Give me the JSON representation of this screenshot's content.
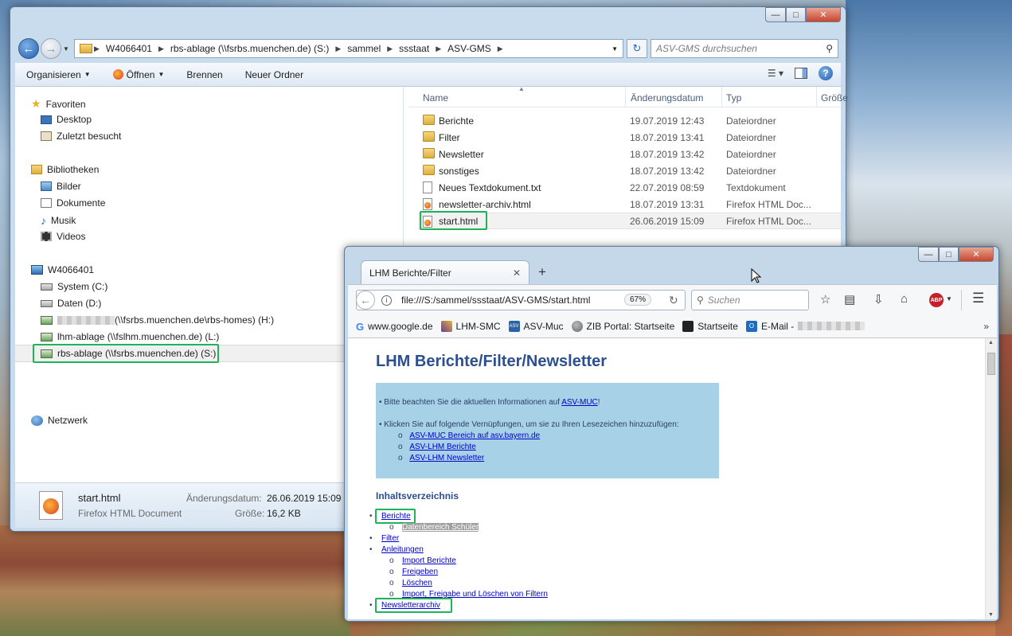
{
  "explorer": {
    "breadcrumb": [
      "W4066401",
      "rbs-ablage (\\\\fsrbs.muenchen.de) (S:)",
      "sammel",
      "ssstaat",
      "ASV-GMS"
    ],
    "search_placeholder": "ASV-GMS durchsuchen",
    "toolbar": {
      "organize": "Organisieren",
      "open": "Öffnen",
      "burn": "Brennen",
      "new_folder": "Neuer Ordner"
    },
    "nav": {
      "favorites": "Favoriten",
      "desktop": "Desktop",
      "recent": "Zuletzt besucht",
      "libraries": "Bibliotheken",
      "pictures": "Bilder",
      "documents": "Dokumente",
      "music": "Musik",
      "videos": "Videos",
      "computer": "W4066401",
      "system": "System  (C:)",
      "data": "Daten (D:)",
      "homes": "(\\\\fsrbs.muenchen.de\\rbs-homes) (H:)",
      "lhm": "lhm-ablage (\\\\fslhm.muenchen.de) (L:)",
      "rbs": "rbs-ablage (\\\\fsrbs.muenchen.de) (S:)",
      "network": "Netzwerk"
    },
    "columns": {
      "name": "Name",
      "date": "Änderungsdatum",
      "type": "Typ",
      "size": "Größe"
    },
    "files": [
      {
        "name": "Berichte",
        "date": "19.07.2019 12:43",
        "type": "Dateiordner",
        "icon": "folder"
      },
      {
        "name": "Filter",
        "date": "18.07.2019 13:41",
        "type": "Dateiordner",
        "icon": "folder"
      },
      {
        "name": "Newsletter",
        "date": "18.07.2019 13:42",
        "type": "Dateiordner",
        "icon": "folder"
      },
      {
        "name": "sonstiges",
        "date": "18.07.2019 13:42",
        "type": "Dateiordner",
        "icon": "folder"
      },
      {
        "name": "Neues Textdokument.txt",
        "date": "22.07.2019 08:59",
        "type": "Textdokument",
        "icon": "txt"
      },
      {
        "name": "newsletter-archiv.html",
        "date": "18.07.2019 13:31",
        "type": "Firefox HTML Doc...",
        "icon": "html"
      },
      {
        "name": "start.html",
        "date": "26.06.2019 15:09",
        "type": "Firefox HTML Doc...",
        "icon": "html"
      }
    ],
    "details": {
      "filename": "start.html",
      "filetype": "Firefox HTML Document",
      "date_label": "Änderungsdatum:",
      "date_value": "26.06.2019 15:09",
      "size_label": "Größe:",
      "size_value": "16,2 KB"
    }
  },
  "firefox": {
    "tab_title": "LHM Berichte/Filter",
    "url": "file:///S:/sammel/ssstaat/ASV-GMS/start.html",
    "zoom": "67%",
    "search_placeholder": "Suchen",
    "bookmarks": [
      "www.google.de",
      "LHM-SMC",
      "ASV-Muc",
      "ZIB Portal: Startseite",
      "Startseite",
      "E-Mail -"
    ],
    "page": {
      "title": "LHM Berichte/Filter/Newsletter",
      "info1_prefix": "Bitte beachten Sie die aktuellen Informationen auf ",
      "info1_link": "ASV-MUC",
      "info1_suffix": "!",
      "info2": "Klicken Sie auf folgende Vernüpfungen, um sie zu Ihren Lesezeichen hinzuzufügen:",
      "info_links": [
        "ASV-MUC Bereich auf asv.bayern.de",
        "ASV-LHM Berichte",
        "ASV-LHM Newsletter"
      ],
      "toc_heading": "Inhaltsverzeichnis",
      "toc": {
        "berichte": "Berichte",
        "datenbereich": "Datenbereich Schüler",
        "filter": "Filter",
        "anleitungen": "Anleitungen",
        "import": "Import Berichte",
        "freigeben": "Freigeben",
        "loeschen": "Löschen",
        "import_filter": "Import, Freigabe und Löschen von Filtern",
        "newsletterarchiv": "Newsletterarchiv"
      }
    }
  }
}
